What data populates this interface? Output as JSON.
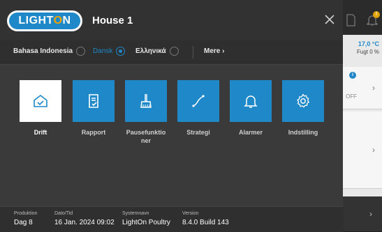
{
  "header": {
    "logo_text_left": "LIGHT",
    "logo_text_o": "O",
    "logo_text_right": "N",
    "title": "House 1"
  },
  "languages": [
    {
      "label": "Bahasa Indonesia",
      "selected": false
    },
    {
      "label": "Dansk",
      "selected": true
    },
    {
      "label": "Ελληνικά",
      "selected": false
    }
  ],
  "more_label": "Mere",
  "menu_tiles": [
    {
      "label": "Drift",
      "icon": "home-check-icon",
      "active": true
    },
    {
      "label": "Rapport",
      "icon": "report-check-icon",
      "active": false
    },
    {
      "label": "Pausefunktio\nner",
      "icon": "broom-icon",
      "active": false
    },
    {
      "label": "Strategi",
      "icon": "strategy-line-icon",
      "active": false
    },
    {
      "label": "Alarmer",
      "icon": "bell-icon",
      "active": false
    },
    {
      "label": "Indstilling",
      "icon": "gear-icon",
      "active": false
    }
  ],
  "footer": {
    "production_label": "Produktion",
    "production_value": "Dag 8",
    "datetime_label": "Dato/Tid",
    "datetime_value": "16 Jan. 2024 09:02",
    "system_label": "Systemnavn",
    "system_value": "LightOn Poultry",
    "version_label": "Version",
    "version_value": "8.4.0 Build 143"
  },
  "background": {
    "temperature": "17,0 °C",
    "humidity": "Fugt 0 %",
    "status": "OFF",
    "info_badge": "i",
    "bell_badge": "!"
  },
  "colors": {
    "accent": "#1e88c8",
    "logo_o": "#f0a400",
    "panel": "#3a3a3a",
    "warning": "#e2a400"
  }
}
